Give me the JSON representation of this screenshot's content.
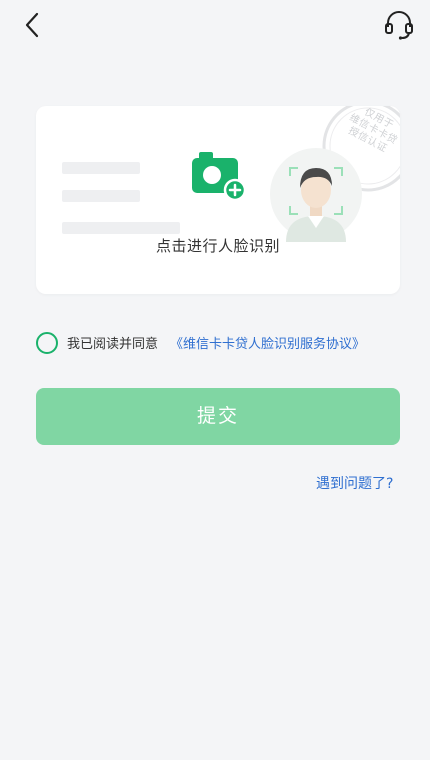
{
  "header": {
    "back_icon": "chevron-left-icon",
    "service_icon": "headset-icon"
  },
  "card": {
    "prompt": "点击进行人脸识别",
    "camera_icon": "camera-add-icon",
    "stamp": [
      "仅用于",
      "维信卡卡贷",
      "授信认证"
    ],
    "accent": "#1ab26b"
  },
  "agreement": {
    "prefix": "我已阅读并同意",
    "link": "《维信卡卡贷人脸识别服务协议》",
    "checked": false
  },
  "submit": {
    "label": "提交",
    "color": "#80d6a3"
  },
  "help": {
    "label": "遇到问题了?"
  }
}
